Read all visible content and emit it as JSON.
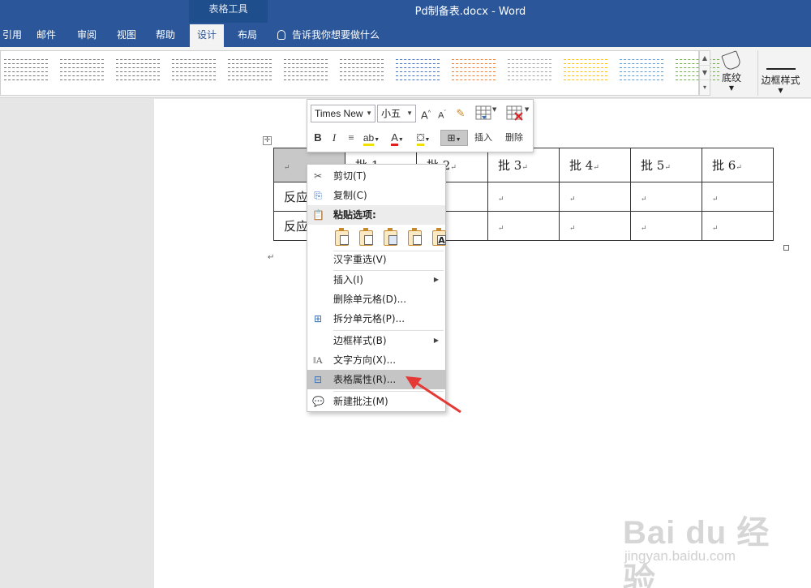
{
  "window": {
    "title": "Pd制备表.docx  -  Word",
    "context_tab_group": "表格工具"
  },
  "tabs": [
    {
      "label": "引用",
      "active": false
    },
    {
      "label": "邮件",
      "active": false
    },
    {
      "label": "审阅",
      "active": false
    },
    {
      "label": "视图",
      "active": false
    },
    {
      "label": "帮助",
      "active": false
    },
    {
      "label": "设计",
      "active": true
    },
    {
      "label": "布局",
      "active": false
    }
  ],
  "tellme": "告诉我你想要做什么",
  "ribbon": {
    "shading_label": "底纹",
    "border_style_label": "边框样式",
    "style_colors": [
      "#777777",
      "#777777",
      "#777777",
      "#777777",
      "#777777",
      "#777777",
      "#777777",
      "#4472c4",
      "#ed7d31",
      "#a5a5a5",
      "#ffc000",
      "#5b9bd5",
      "#70ad47"
    ]
  },
  "mini_toolbar": {
    "font_name": "Times New",
    "font_size": "小五",
    "bold": "B",
    "italic": "I",
    "insert_label": "插入",
    "delete_label": "删除",
    "font_color": "#e02020",
    "highlight_color": "#f0e000"
  },
  "table": {
    "rows": [
      [
        "",
        "批 1",
        "批 2",
        "批 3",
        "批 4",
        "批 5",
        "批 6"
      ],
      [
        "反应",
        "",
        "",
        "",
        "",
        "",
        ""
      ],
      [
        "反应",
        "",
        "",
        "",
        "",
        "",
        ""
      ]
    ],
    "para_mark": "↵"
  },
  "context_menu": {
    "cut": "剪切(T)",
    "copy": "复制(C)",
    "paste_options": "粘贴选项:",
    "reconvert": "汉字重选(V)",
    "insert": "插入(I)",
    "delete_cells": "删除单元格(D)...",
    "split_cells": "拆分单元格(P)...",
    "border_styles": "边框样式(B)",
    "text_direction": "文字方向(X)...",
    "table_properties": "表格属性(R)...",
    "new_comment": "新建批注(M)"
  },
  "annotation": {
    "arrow_color": "#e53935"
  },
  "watermark": {
    "brand": "Bai du 经验",
    "url": "jingyan.baidu.com"
  }
}
